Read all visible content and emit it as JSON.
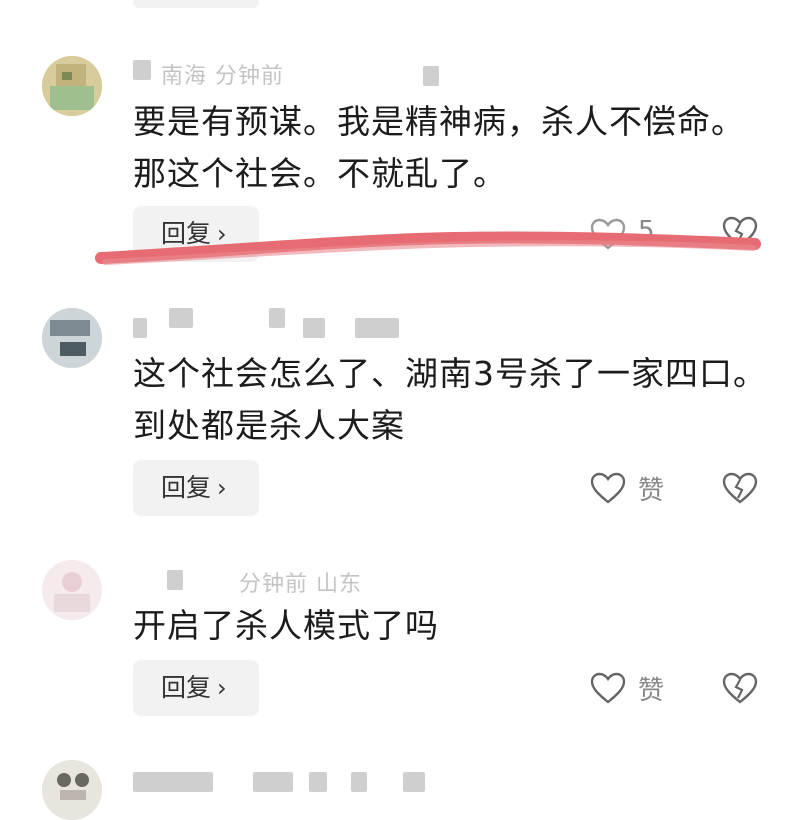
{
  "comments": [
    {
      "meta_text": "南海  分钟前",
      "text": "要是有预谋。我是精神病，杀人不偿命。那这个社会。不就乱了。",
      "reply_label": "回复",
      "like_label": "5"
    },
    {
      "text": "这个社会怎么了、湖南3号杀了一家四口。到处都是杀人大案",
      "reply_label": "回复",
      "like_label": "赞"
    },
    {
      "meta_text": "分钟前  山东",
      "text": "开启了杀人模式了吗",
      "reply_label": "回复",
      "like_label": "赞"
    },
    {
      "text": ""
    }
  ],
  "icons": {
    "like": "heart-outline-icon",
    "dislike": "broken-heart-icon",
    "reply_chevron": "chevron-right-icon"
  },
  "colors": {
    "highlight_stroke": "#e76b72",
    "text": "#1c1c1c",
    "muted": "#888888",
    "reply_bg": "#f2f2f2"
  }
}
